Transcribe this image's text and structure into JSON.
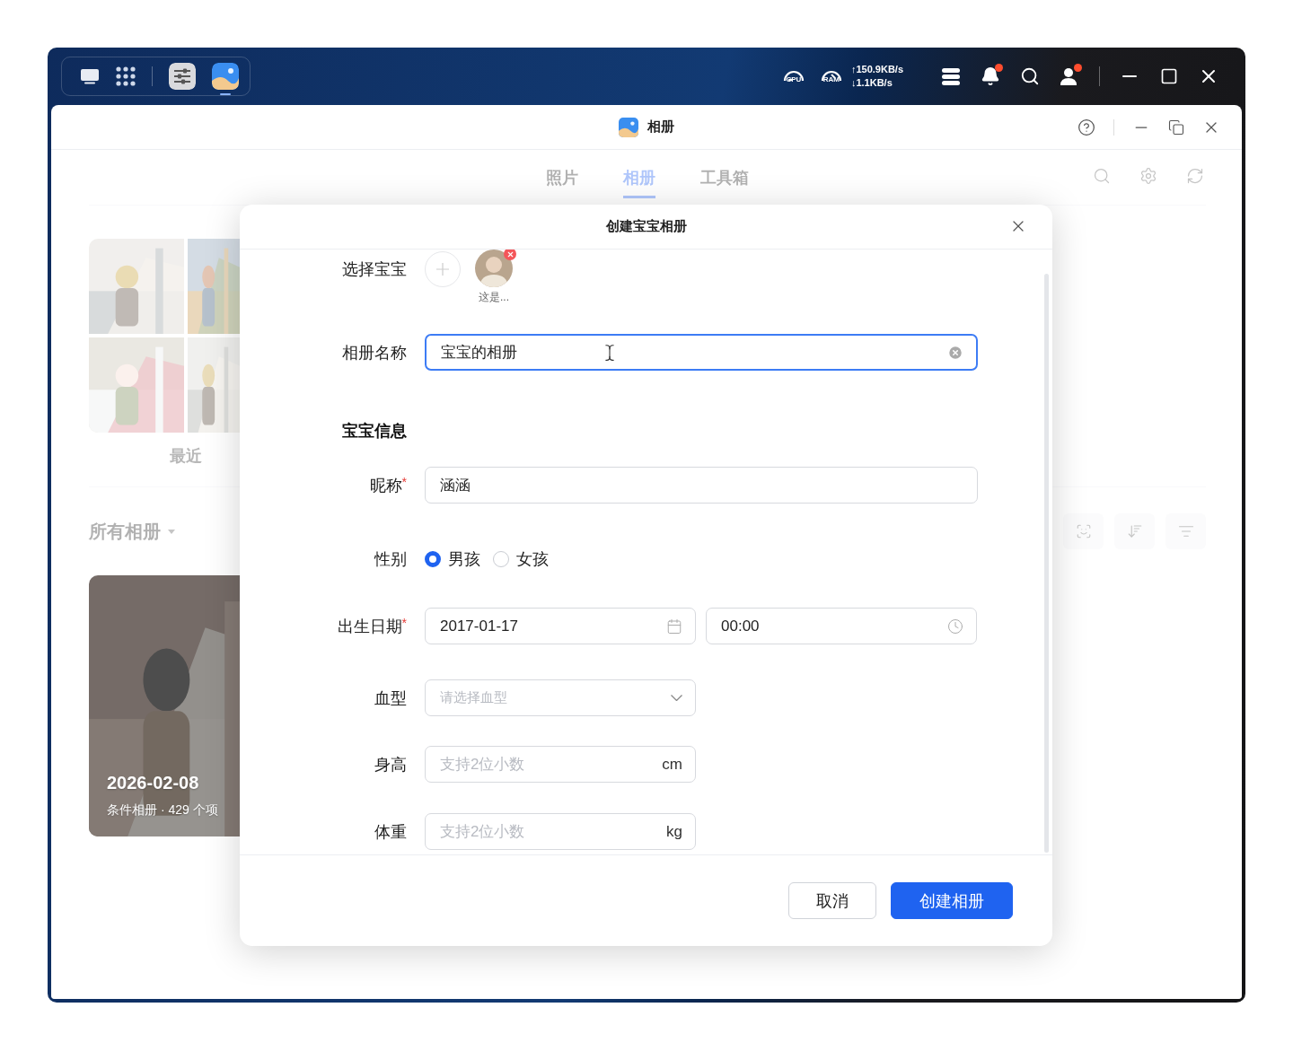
{
  "taskbar": {
    "apps": [
      {
        "kind": "settings",
        "active": false
      },
      {
        "kind": "photos",
        "active": true
      }
    ],
    "cpu_label": "CPU",
    "ram_label": "RAM",
    "upload": "↑150.9KB/s",
    "download": "↓1.1KB/s",
    "bell_badge": true,
    "user_badge": true
  },
  "window": {
    "title": "相册"
  },
  "tabs": [
    {
      "label": "照片",
      "selected": false
    },
    {
      "label": "相册",
      "selected": true
    },
    {
      "label": "工具箱",
      "selected": false
    }
  ],
  "recent": {
    "label": "最近"
  },
  "all_albums": {
    "label": "所有相册"
  },
  "album_card": {
    "date": "2026-02-08",
    "meta": "条件相册 · 429 个项"
  },
  "dialog": {
    "title": "创建宝宝相册",
    "baby_picker": {
      "label": "选择宝宝",
      "babies": [
        {
          "caption": "这是..."
        }
      ]
    },
    "album_name": {
      "label": "相册名称",
      "value": "宝宝的相册",
      "focused": true
    },
    "section": "宝宝信息",
    "nickname": {
      "label": "昵称",
      "required_mark": "*",
      "value": "涵涵"
    },
    "gender": {
      "label": "性别",
      "options": [
        {
          "label": "男孩",
          "selected": true
        },
        {
          "label": "女孩",
          "selected": false
        }
      ]
    },
    "birth": {
      "label": "出生日期",
      "required_mark": "*",
      "date": "2017-01-17",
      "time": "00:00"
    },
    "blood": {
      "label": "血型",
      "placeholder": "请选择血型"
    },
    "height": {
      "label": "身高",
      "placeholder": "支持2位小数",
      "unit": "cm"
    },
    "weight": {
      "label": "体重",
      "placeholder": "支持2位小数",
      "unit": "kg"
    },
    "buttons": [
      {
        "label": "取消",
        "kind": "secondary"
      },
      {
        "label": "创建相册",
        "kind": "primary"
      }
    ]
  }
}
